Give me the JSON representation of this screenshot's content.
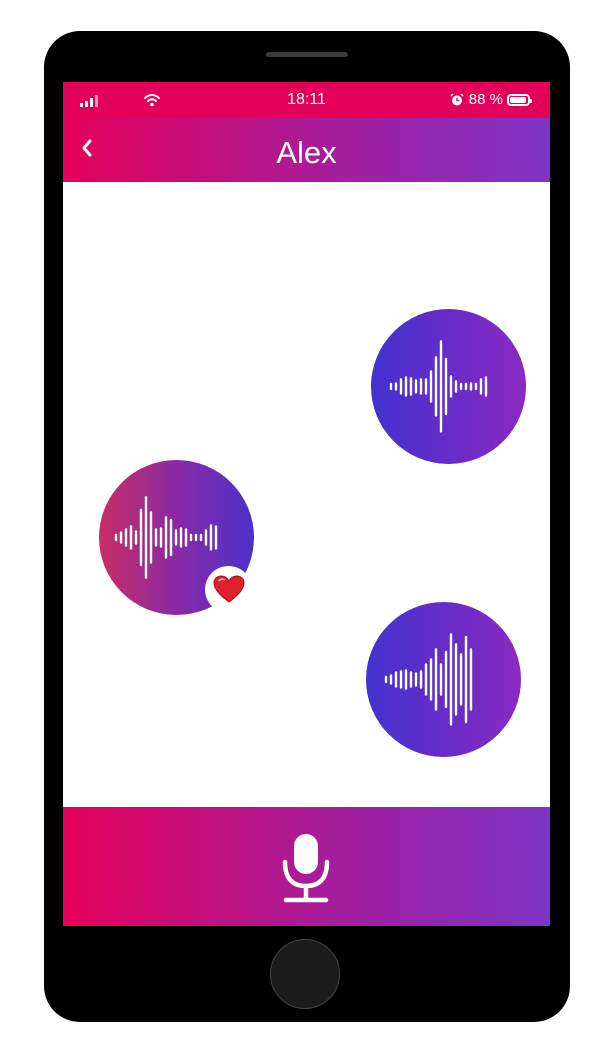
{
  "status_bar": {
    "time": "18:11",
    "battery": "88 %",
    "icons": [
      "signal-icon",
      "wifi-icon",
      "alarm-icon",
      "battery-icon"
    ]
  },
  "header": {
    "title": "Alex",
    "back_icon": "chevron-left-icon"
  },
  "messages": [
    {
      "side": "right",
      "type": "voice",
      "icon": "waveform-icon"
    },
    {
      "side": "left",
      "type": "voice",
      "icon": "waveform-icon",
      "reaction": "heart-icon"
    },
    {
      "side": "right",
      "type": "voice",
      "icon": "waveform-icon"
    }
  ],
  "composer": {
    "icon": "microphone-icon"
  },
  "colors": {
    "status_bar": "#e30059",
    "gradient_start": "#e5005a",
    "gradient_end": "#7e33c6",
    "bubble_blue": "#4232cf",
    "bubble_purple": "#8a2bc2",
    "bubble_pink": "#c82e63",
    "heart": "#e0202a"
  }
}
